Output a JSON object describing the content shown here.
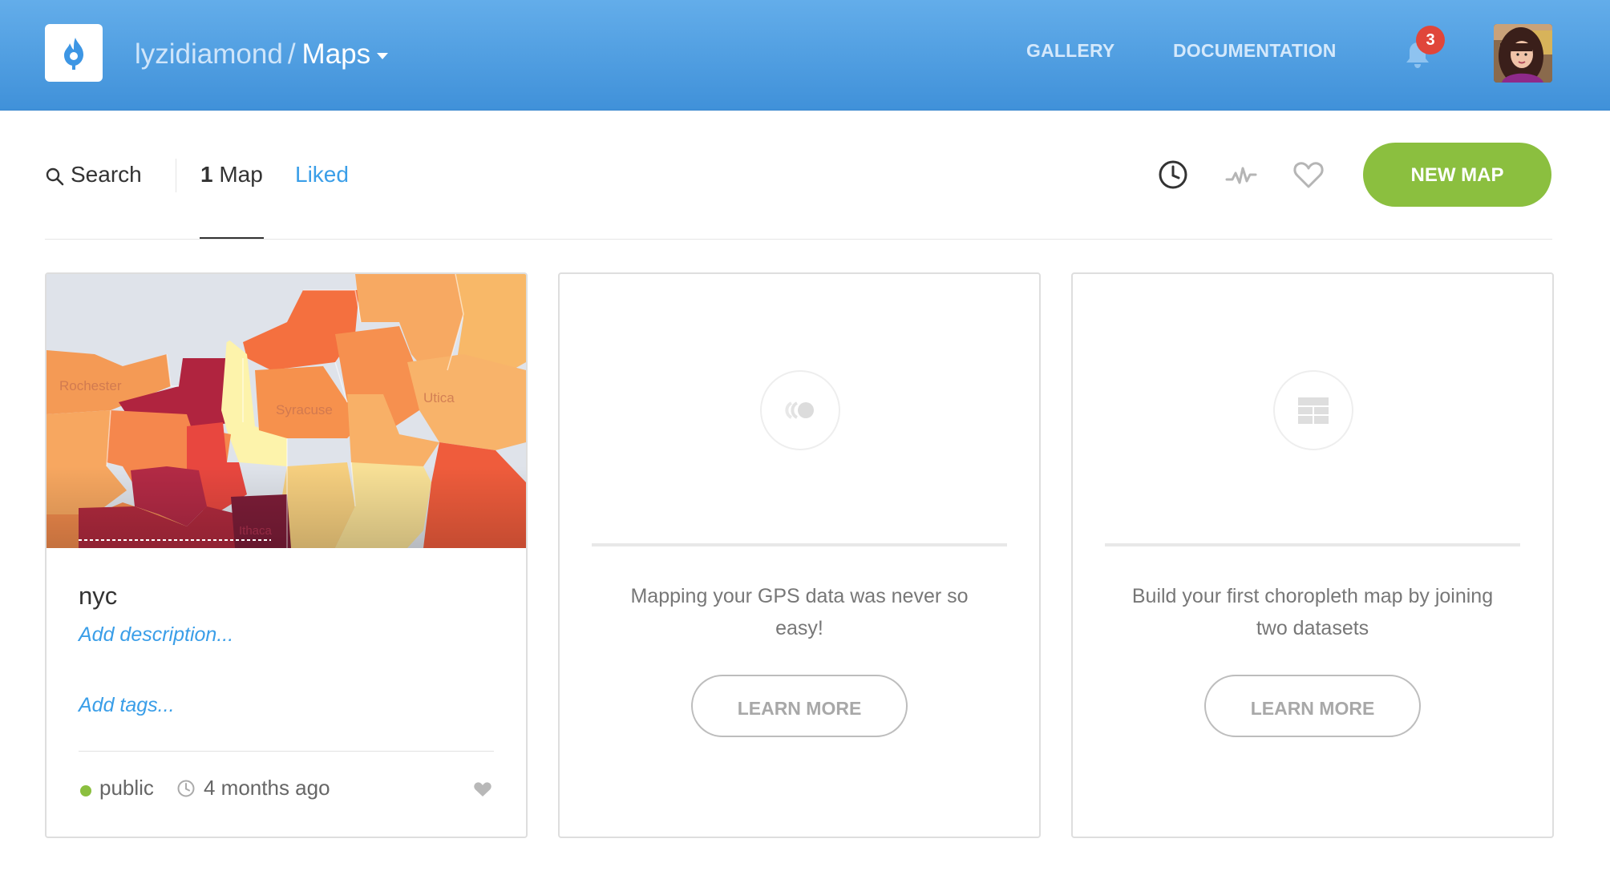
{
  "header": {
    "logo_icon": "carto-flame-icon",
    "user": "lyzidiamond",
    "separator": "/",
    "section": "Maps",
    "nav": [
      {
        "label": "GALLERY"
      },
      {
        "label": "DOCUMENTATION"
      }
    ],
    "notifications_count": "3",
    "avatar_icon": "user-avatar"
  },
  "toolbar": {
    "search_label": "Search",
    "maps_count": "1",
    "maps_label": "Map",
    "liked_label": "Liked",
    "icons": [
      "clock-icon",
      "activity-icon",
      "heart-icon"
    ],
    "new_map_label": "NEW MAP"
  },
  "cards": [
    {
      "title": "nyc",
      "add_description": "Add description...",
      "add_tags": "Add tags...",
      "privacy": "public",
      "updated": "4 months ago",
      "map_labels": [
        "Rochester",
        "Syracuse",
        "Utica",
        "Ithaca"
      ]
    },
    {
      "icon": "gps-track-icon",
      "text": "Mapping your GPS data was never so easy!",
      "button": "LEARN MORE"
    },
    {
      "icon": "choropleth-grid-icon",
      "text": "Build your first choropleth map by joining two datasets",
      "button": "LEARN MORE"
    }
  ],
  "colors": {
    "header_blue": "#4f9ee2",
    "accent_green": "#8bbf3f",
    "link_blue": "#3a9ee8",
    "badge_red": "#e0463a"
  }
}
